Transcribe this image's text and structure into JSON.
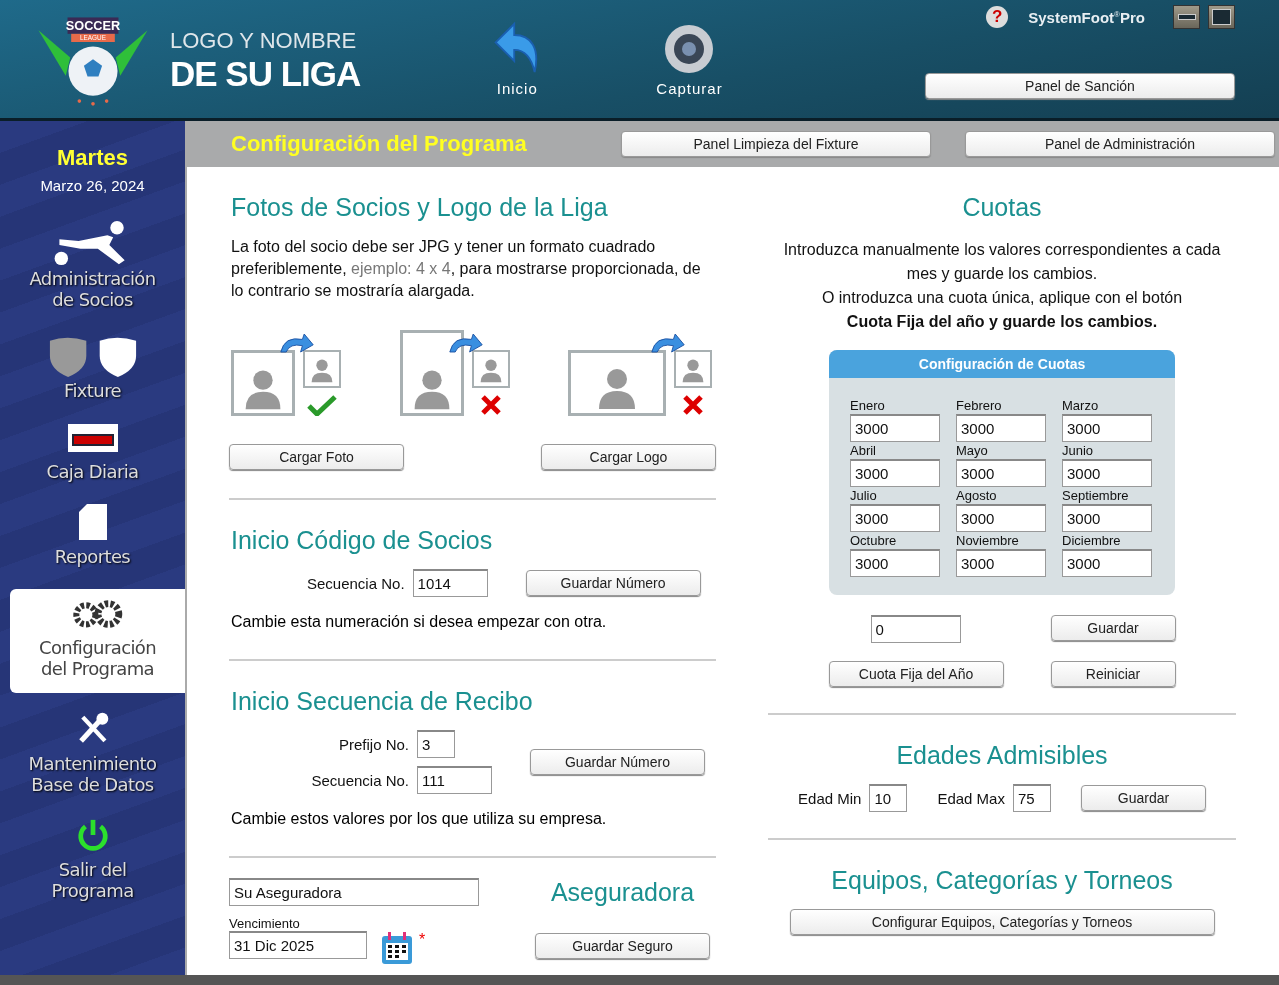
{
  "header": {
    "logo_title_top": "LOGO Y NOMBRE",
    "logo_title_bottom": "DE SU LIGA",
    "logo_badge": "SOCCER",
    "logo_ribbon": "LEAGUE",
    "toolbar": [
      "Inicio",
      "Capturar"
    ],
    "help": "?",
    "brand": "SystemFoot",
    "brand_mark": "®",
    "brand_suffix": "Pro",
    "sanction_button": "Panel de Sanción"
  },
  "sidebar": {
    "day": "Martes",
    "date": "Marzo 26, 2024",
    "items": [
      {
        "label": "Administración de Socios",
        "selected": false
      },
      {
        "label": "Fixture",
        "selected": false
      },
      {
        "label": "Caja Diaria",
        "selected": false
      },
      {
        "label": "Reportes",
        "selected": false
      },
      {
        "label": "Configuración del Programa",
        "selected": true
      },
      {
        "label": "Mantenimiento Base de Datos",
        "selected": false
      },
      {
        "label": "Salir del Programa",
        "selected": false
      }
    ]
  },
  "title_bar": {
    "title": "Configuración del Programa",
    "buttons": [
      "Panel Limpieza del Fixture",
      "Panel de Administración"
    ]
  },
  "photos": {
    "heading": "Fotos de Socios y Logo de la Liga",
    "text_before": "La foto del socio debe ser JPG y tener un formato cuadrado preferiblemente,",
    "example": "ejemplo: 4 x 4",
    "text_after": ", para mostrarse proporcionada, de lo contrario se mostraría alargada.",
    "examples": [
      {
        "kind": "square",
        "valid": true
      },
      {
        "kind": "tall",
        "valid": false
      },
      {
        "kind": "wide",
        "valid": false
      }
    ],
    "buttons": [
      "Cargar Foto",
      "Cargar Logo"
    ]
  },
  "member_code": {
    "heading": "Inicio Código de Socios",
    "label": "Secuencia No.",
    "value": "1014",
    "button": "Guardar Número",
    "note": "Cambie esta numeración si desea empezar con otra."
  },
  "receipt": {
    "heading": "Inicio Secuencia de Recibo",
    "prefix_label": "Prefijo No.",
    "prefix": "3",
    "seq_label": "Secuencia No.",
    "seq": "111",
    "button": "Guardar Número",
    "note": "Cambie estos valores por los que utiliza su empresa."
  },
  "insurer": {
    "name": "Su Aseguradora",
    "due_label": "Vencimiento",
    "due": "31 Dic 2025",
    "required": "*",
    "heading": "Aseguradora",
    "button": "Guardar Seguro"
  },
  "fees": {
    "heading": "Cuotas",
    "line1": "Introduzca manualmente los valores correspondientes a cada mes y guarde los cambios.",
    "line2": "O introduzca una cuota única, aplique con el botón",
    "line3": "Cuota Fija del año y guarde los cambios.",
    "panel_title": "Configuración de Cuotas",
    "months": [
      {
        "label": "Enero",
        "value": "3000"
      },
      {
        "label": "Febrero",
        "value": "3000"
      },
      {
        "label": "Marzo",
        "value": "3000"
      },
      {
        "label": "Abril",
        "value": "3000"
      },
      {
        "label": "Mayo",
        "value": "3000"
      },
      {
        "label": "Junio",
        "value": "3000"
      },
      {
        "label": "Julio",
        "value": "3000"
      },
      {
        "label": "Agosto",
        "value": "3000"
      },
      {
        "label": "Septiembre",
        "value": "3000"
      },
      {
        "label": "Octubre",
        "value": "3000"
      },
      {
        "label": "Noviembre",
        "value": "3000"
      },
      {
        "label": "Diciembre",
        "value": "3000"
      }
    ],
    "fixed_value": "0",
    "save": "Guardar",
    "fixed_button": "Cuota Fija del Año",
    "reset": "Reiniciar"
  },
  "ages": {
    "heading": "Edades Admisibles",
    "min_label": "Edad Min",
    "min": "10",
    "max_label": "Edad Max",
    "max": "75",
    "button": "Guardar"
  },
  "teams": {
    "heading": "Equipos, Categorías y Torneos",
    "button": "Configurar Equipos, Categorías y Torneos"
  }
}
